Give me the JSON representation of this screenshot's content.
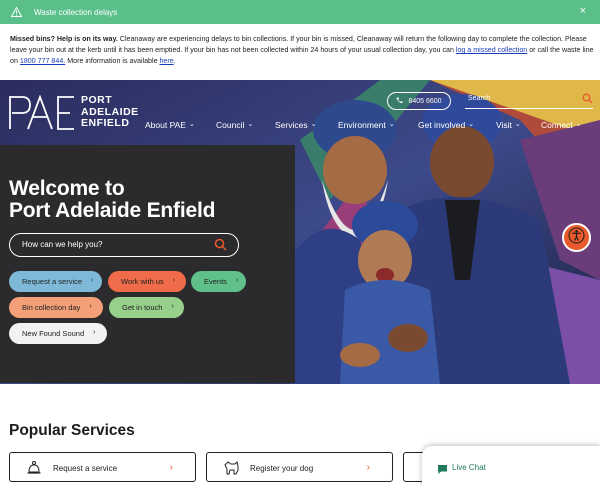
{
  "alert": {
    "title": "Waste collection delays",
    "close_label": "×",
    "icon": "warning-triangle-icon"
  },
  "notice": {
    "bold": "Missed bins? Help is on its way.",
    "text1": " Cleanaway are experiencing delays to bin collections. If your bin is missed, Cleanaway will return the following day to complete the collection. Please leave your bin out at the kerb until it has been emptied. If your bin has not been collected within 24 hours of your usual collection day, you can ",
    "link1": "log a missed collection",
    "text2": " or call the waste line on ",
    "link2": "1800 777 844.",
    "text3": " More information is available ",
    "link3": "here",
    "text4": "."
  },
  "header": {
    "logo_lines": [
      "PORT",
      "ADELAIDE",
      "ENFIELD"
    ],
    "phone": "8405 6600",
    "search_placeholder": "Search",
    "nav": [
      "About PAE",
      "Council",
      "Services",
      "Environment",
      "Get involved",
      "Visit",
      "Connect"
    ]
  },
  "hero": {
    "title_line1": "Welcome to",
    "title_line2": "Port Adelaide Enfield",
    "help_placeholder": "How can we help you?",
    "pills": [
      {
        "label": "Request a service",
        "color": "#7fb9d8"
      },
      {
        "label": "Work with us",
        "color": "#ef6b4a"
      },
      {
        "label": "Events",
        "color": "#5fc089"
      },
      {
        "label": "Bin collection day",
        "color": "#f3a079"
      },
      {
        "label": "Get in touch",
        "color": "#96d08a"
      },
      {
        "label": "New Found Sound",
        "color": "#f2f2f2"
      }
    ]
  },
  "popular": {
    "title": "Popular Services",
    "cards": [
      "Request a service",
      "Register your dog"
    ]
  },
  "chat": {
    "label": "Live Chat"
  },
  "colors": {
    "alert_green": "#5bbf8a",
    "accent_orange": "#e85a2b",
    "dark_panel": "#2b2b2d"
  }
}
